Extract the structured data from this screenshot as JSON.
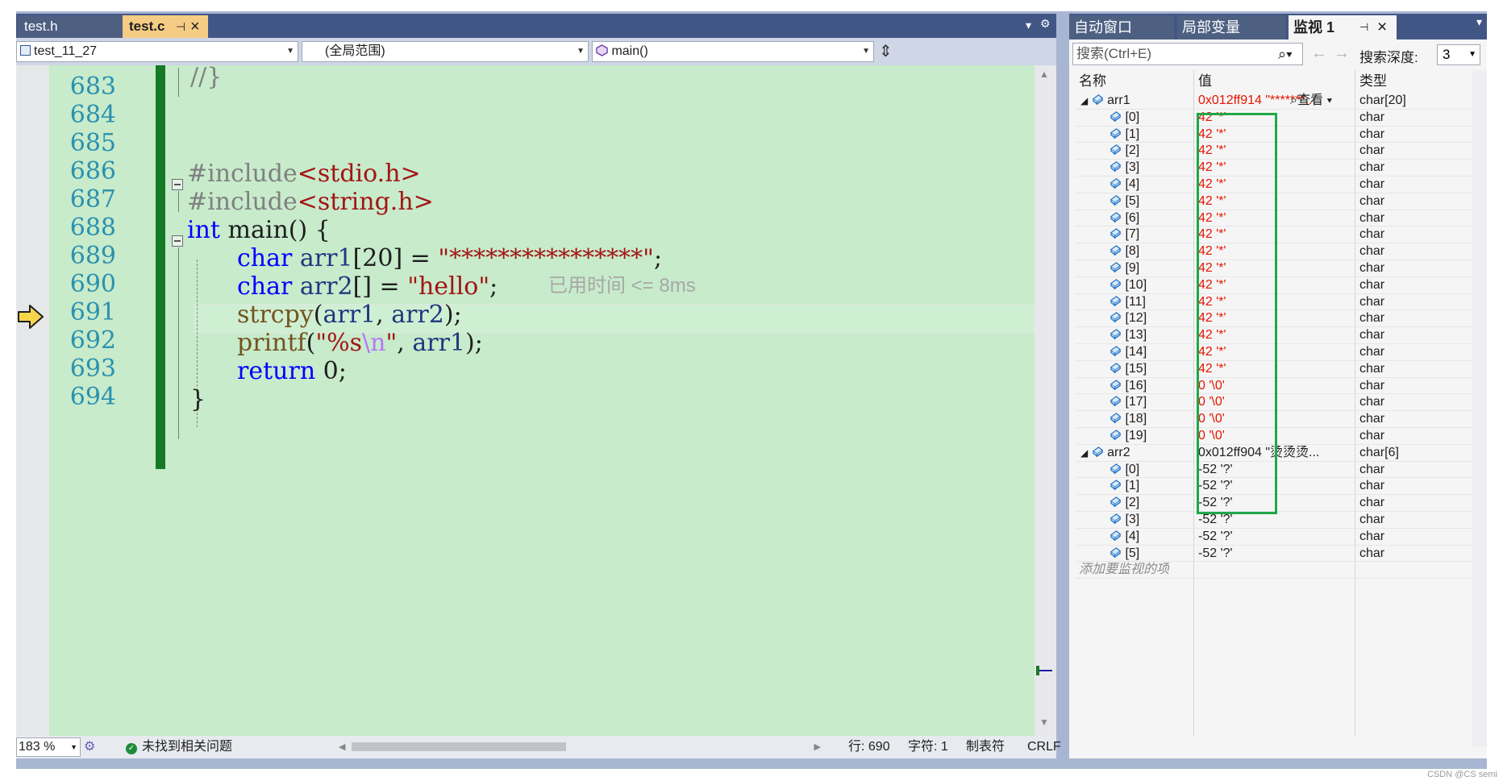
{
  "editor": {
    "tabs": [
      {
        "label": "test.h"
      },
      {
        "label": "test.c"
      }
    ],
    "nav": {
      "project": "test_11_27",
      "scope": "(全局范围)",
      "member": "main()"
    },
    "lines": [
      {
        "num": "683"
      },
      {
        "num": "684"
      },
      {
        "num": "685"
      },
      {
        "num": "686"
      },
      {
        "num": "687"
      },
      {
        "num": "688"
      },
      {
        "num": "689"
      },
      {
        "num": "690"
      },
      {
        "num": "691"
      },
      {
        "num": "692"
      },
      {
        "num": "693"
      },
      {
        "num": "694"
      }
    ],
    "code": {
      "l683": "//}",
      "l686_dir": "#include",
      "l686_hdr": "<stdio.h>",
      "l687_dir": "#include",
      "l687_hdr": "<string.h>",
      "l688_kw": "int",
      "l688_rest": " main() {",
      "l689_kw": "char",
      "l689_var": " arr1",
      "l689_mid": "[20] = ",
      "l689_str": "\"****************\"",
      "l689_end": ";",
      "l690_kw": "char",
      "l690_var": " arr2",
      "l690_mid": "[] = ",
      "l690_str": "\"hello\"",
      "l690_end": ";",
      "l691_fn": "strcpy",
      "l691_a": "(",
      "l691_v1": "arr1",
      "l691_b": ", ",
      "l691_v2": "arr2",
      "l691_c": ");",
      "l692_fn": "printf",
      "l692_a": "(",
      "l692_s1": "\"%s",
      "l692_esc": "\\n",
      "l692_s2": "\"",
      "l692_b": ", ",
      "l692_v": "arr1",
      "l692_c": ");",
      "l693_kw": "return",
      "l693_rest": " 0;",
      "l694": "}"
    },
    "elapsed": "已用时间 <= 8ms"
  },
  "statusbar": {
    "zoom": "183 %",
    "issues": "未找到相关问题",
    "line": "行: 690",
    "col": "字符: 1",
    "tabs": "制表符",
    "eol": "CRLF"
  },
  "watch": {
    "tabs": [
      {
        "label": "自动窗口"
      },
      {
        "label": "局部变量"
      },
      {
        "label": "监视 1"
      }
    ],
    "search_placeholder": "搜索(Ctrl+E)",
    "depth_label": "搜索深度:",
    "depth": "3",
    "columns": {
      "name": "名称",
      "value": "值",
      "type": "类型"
    },
    "arr1": {
      "name": "arr1",
      "value": "0x012ff914 \"*******...",
      "view": "查看",
      "type": "char[20]"
    },
    "arr1_items": [
      {
        "idx": "[0]",
        "val": "42 '*'",
        "type": "char"
      },
      {
        "idx": "[1]",
        "val": "42 '*'",
        "type": "char"
      },
      {
        "idx": "[2]",
        "val": "42 '*'",
        "type": "char"
      },
      {
        "idx": "[3]",
        "val": "42 '*'",
        "type": "char"
      },
      {
        "idx": "[4]",
        "val": "42 '*'",
        "type": "char"
      },
      {
        "idx": "[5]",
        "val": "42 '*'",
        "type": "char"
      },
      {
        "idx": "[6]",
        "val": "42 '*'",
        "type": "char"
      },
      {
        "idx": "[7]",
        "val": "42 '*'",
        "type": "char"
      },
      {
        "idx": "[8]",
        "val": "42 '*'",
        "type": "char"
      },
      {
        "idx": "[9]",
        "val": "42 '*'",
        "type": "char"
      },
      {
        "idx": "[10]",
        "val": "42 '*'",
        "type": "char"
      },
      {
        "idx": "[11]",
        "val": "42 '*'",
        "type": "char"
      },
      {
        "idx": "[12]",
        "val": "42 '*'",
        "type": "char"
      },
      {
        "idx": "[13]",
        "val": "42 '*'",
        "type": "char"
      },
      {
        "idx": "[14]",
        "val": "42 '*'",
        "type": "char"
      },
      {
        "idx": "[15]",
        "val": "42 '*'",
        "type": "char"
      },
      {
        "idx": "[16]",
        "val": "0 '\\0'",
        "type": "char"
      },
      {
        "idx": "[17]",
        "val": "0 '\\0'",
        "type": "char"
      },
      {
        "idx": "[18]",
        "val": "0 '\\0'",
        "type": "char"
      },
      {
        "idx": "[19]",
        "val": "0 '\\0'",
        "type": "char"
      }
    ],
    "arr2": {
      "name": "arr2",
      "value": "0x012ff904 \"烫烫烫...",
      "type": "char[6]"
    },
    "arr2_items": [
      {
        "idx": "[0]",
        "val": "-52 '?'",
        "type": "char"
      },
      {
        "idx": "[1]",
        "val": "-52 '?'",
        "type": "char"
      },
      {
        "idx": "[2]",
        "val": "-52 '?'",
        "type": "char"
      },
      {
        "idx": "[3]",
        "val": "-52 '?'",
        "type": "char"
      },
      {
        "idx": "[4]",
        "val": "-52 '?'",
        "type": "char"
      },
      {
        "idx": "[5]",
        "val": "-52 '?'",
        "type": "char"
      }
    ],
    "add_item": "添加要监视的项"
  },
  "credit": "CSDN @CS semi",
  "colors": {
    "tab_bar": "#425686",
    "active_tab": "#f5cc84",
    "code_bg": "#c7ebcb",
    "keyword": "#0000ff",
    "string": "#a31515",
    "changed_value": "#e51400",
    "highlight_box": "#1fa848"
  }
}
